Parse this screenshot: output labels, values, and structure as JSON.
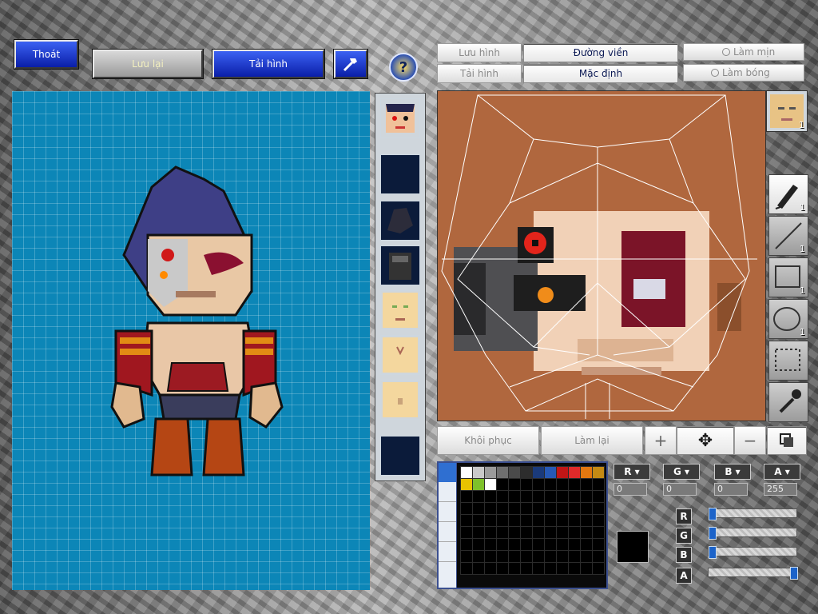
{
  "top_buttons": {
    "exit": "Thoát",
    "save": "Lưu lại",
    "reload": "Tải hình"
  },
  "editor_buttons": {
    "save_image": "Lưu hình",
    "load_image": "Tải hình",
    "outline": "Đường viền",
    "default": "Mặc định",
    "smooth": "Làm mịn",
    "shade": "Làm bóng"
  },
  "bottom_buttons": {
    "restore": "Khôi phục",
    "redo": "Làm lại"
  },
  "tool_counts": {
    "pencil": "1",
    "line": "1",
    "rect": "1",
    "ellipse": "1",
    "face": "1"
  },
  "channels": {
    "r_value": "0",
    "g_value": "0",
    "b_value": "0",
    "a_value": "255",
    "r_level": 0,
    "g_level": 0,
    "b_level": 0,
    "a_level": 1
  },
  "current_color": "#000000",
  "colors": {
    "canvas_bg": "#b0673e",
    "grid_bg": "#0c86b7",
    "button_blue": "#1d3ad8"
  },
  "palette": [
    "#ffffff",
    "#c9c9c9",
    "#9b9b9b",
    "#6f6f6f",
    "#4a4a4a",
    "#2d2d2d",
    "#1a3a7a",
    "#2659b5",
    "#c01616",
    "#e02a2a",
    "#e27710",
    "#c48a14",
    "#e8c200",
    "#7ec12a",
    "#ffffff"
  ],
  "icons": [
    "help-icon",
    "hammer-icon",
    "pencil-icon",
    "line-icon",
    "rectangle-icon",
    "ellipse-icon",
    "selection-icon",
    "eyedropper-icon",
    "plus-icon",
    "move-icon",
    "minus-icon",
    "layers-icon"
  ]
}
